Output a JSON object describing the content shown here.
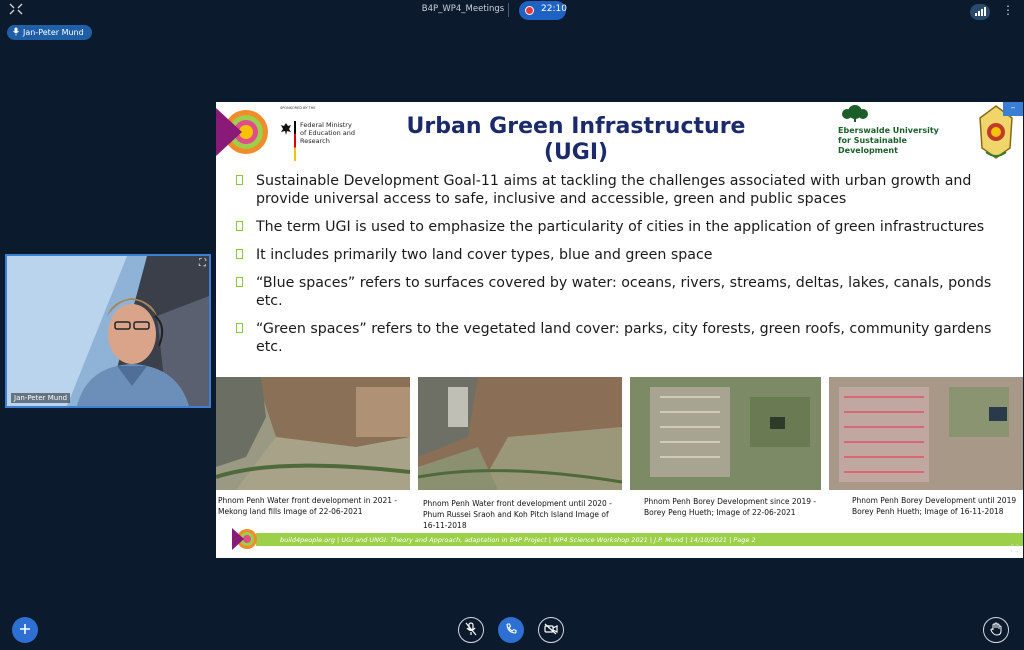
{
  "topbar": {
    "meeting_title": "B4P_WP4_Meetings",
    "recording_time": "22:10"
  },
  "presenter": {
    "name": "Jan-Peter Mund"
  },
  "camera": {
    "name": "Jan-Peter Mund"
  },
  "slide": {
    "title_line1": "Urban Green Infrastructure",
    "title_line2": "(UGI)",
    "sponsor_label": "SPONSORED BY THE",
    "ministry": "Federal Ministry of Education and Research",
    "university_line1": "Eberswalde University",
    "university_line2": "for Sustainable",
    "university_line3": "Development",
    "bullets": [
      "Sustainable Development Goal-11 aims at tackling the challenges associated with urban growth and provide universal access to safe, inclusive and accessible, green and public spaces",
      "The term UGI is used to emphasize the particularity of cities in the application of green infrastructures",
      "It includes primarily two land cover types, blue and green space",
      "“Blue spaces” refers to surfaces covered by water: oceans, rivers, streams, deltas, lakes, canals, ponds etc.",
      "“Green spaces” refers to the vegetated land cover: parks, city forests, green roofs, community gardens etc."
    ],
    "captions": [
      "Phnom Penh Water front development in 2021 - Mekong land fills Image of 22-06-2021",
      "Phnom Penh Water front development until 2020 - Phum Russei Sraoh and Koh Pitch Island Image of 16-11-2018",
      "Phnom Penh Borey Development since 2019 - Borey Peng Hueth; Image of 22-06-2021",
      "Phnom Penh Borey Development until 2019 Borey Penh Hueth; Image of 16-11-2018"
    ],
    "footer": "build4people.org    |   UGI and UNGI: Theory and Approach, adaptation in B4P Project  |  WP4 Science Workshop 2021  |  J.P. Mund                 |  14/10/2021  |            Page 2"
  },
  "colors": {
    "background": "#0c1a2e",
    "accent_blue": "#2d6fd2",
    "title_blue": "#1a2a6a",
    "footer_green": "#9ccf4a",
    "university_green": "#1b5e2a"
  },
  "icons": {
    "top_left": "collapse-icon",
    "mic": "mic-icon",
    "camera_expand": "expand-icon",
    "add": "plus-icon",
    "mute": "mic-off-icon",
    "hangup": "phone-icon",
    "video": "video-off-icon",
    "hand": "raise-hand-icon"
  }
}
